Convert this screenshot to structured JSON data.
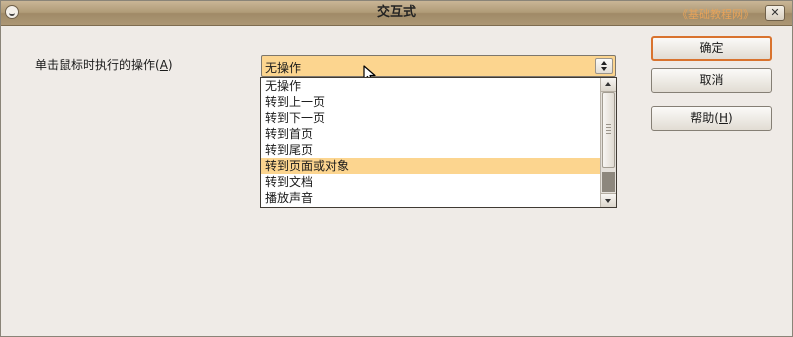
{
  "window": {
    "title": "交互式",
    "watermark": "《基础教程网》",
    "close_label": "✕"
  },
  "form": {
    "action_label_pre": "单击鼠标时执行的操作(",
    "action_label_mnemonic": "A",
    "action_label_post": ")",
    "selected_action": "无操作"
  },
  "dropdown": {
    "options": [
      {
        "label": "无操作",
        "highlighted": false
      },
      {
        "label": "转到上一页",
        "highlighted": false
      },
      {
        "label": "转到下一页",
        "highlighted": false
      },
      {
        "label": "转到首页",
        "highlighted": false
      },
      {
        "label": "转到尾页",
        "highlighted": false
      },
      {
        "label": "转到页面或对象",
        "highlighted": true
      },
      {
        "label": "转到文档",
        "highlighted": false
      },
      {
        "label": "播放声音",
        "highlighted": false
      }
    ]
  },
  "buttons": {
    "ok_label": "确定",
    "cancel_label": "取消",
    "help_label_pre": "帮助(",
    "help_mnemonic": "H",
    "help_label_post": ")"
  },
  "colors": {
    "accent": "#fcd58f",
    "default_button_border": "#d9732e",
    "titlebar": "#b09b77",
    "watermark": "#e6a35a"
  },
  "icons": {
    "window_menu": "window-menu-icon",
    "close": "close-icon",
    "spinner": "up-down-arrows-icon",
    "pointer": "mouse-pointer-icon"
  }
}
